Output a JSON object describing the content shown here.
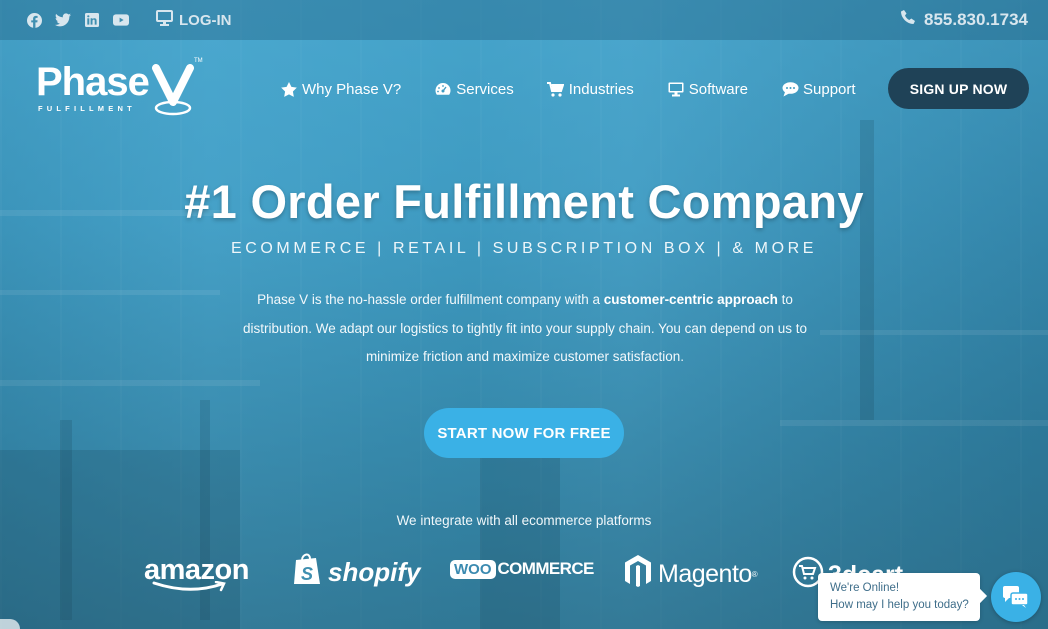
{
  "topbar": {
    "social": [
      {
        "name": "facebook-icon"
      },
      {
        "name": "twitter-icon"
      },
      {
        "name": "linkedin-icon"
      },
      {
        "name": "youtube-icon"
      }
    ],
    "login_label": "LOG-IN",
    "phone": "855.830.1734"
  },
  "logo": {
    "word": "Phase",
    "sub": "FULFILLMENT",
    "tm": "TM"
  },
  "nav": {
    "items": [
      {
        "label": "Why Phase V?",
        "icon": "star-icon"
      },
      {
        "label": "Services",
        "icon": "dashboard-icon"
      },
      {
        "label": "Industries",
        "icon": "cart-icon"
      },
      {
        "label": "Software",
        "icon": "desktop-icon"
      },
      {
        "label": "Support",
        "icon": "comment-icon"
      }
    ],
    "signup_label": "SIGN UP NOW"
  },
  "hero": {
    "title": "#1 Order Fulfillment Company",
    "subtitle": "ECOMMERCE | RETAIL | SUBSCRIPTION BOX | & MORE",
    "desc_before": "Phase V is the no-hassle order fulfillment company with a ",
    "desc_bold": "customer-centric approach",
    "desc_after": " to distribution. We adapt our logistics to tightly fit into your supply chain. You can depend on us to minimize friction and maximize customer satisfaction.",
    "cta_label": "START NOW FOR FREE",
    "integrate_text": "We integrate with all ecommerce platforms"
  },
  "platforms": {
    "amazon": "amazon",
    "shopify": "shopify",
    "woo_box": "WOO",
    "woo_text": "COMMERCE",
    "magento": "Magento",
    "threedcart": "3dcart"
  },
  "colors": {
    "accent": "#3ab1e6",
    "signup_bg": "#1f4257",
    "chat_text": "#3f6e8a"
  },
  "chat": {
    "title": "We're Online!",
    "message": "How may I help you today?"
  }
}
